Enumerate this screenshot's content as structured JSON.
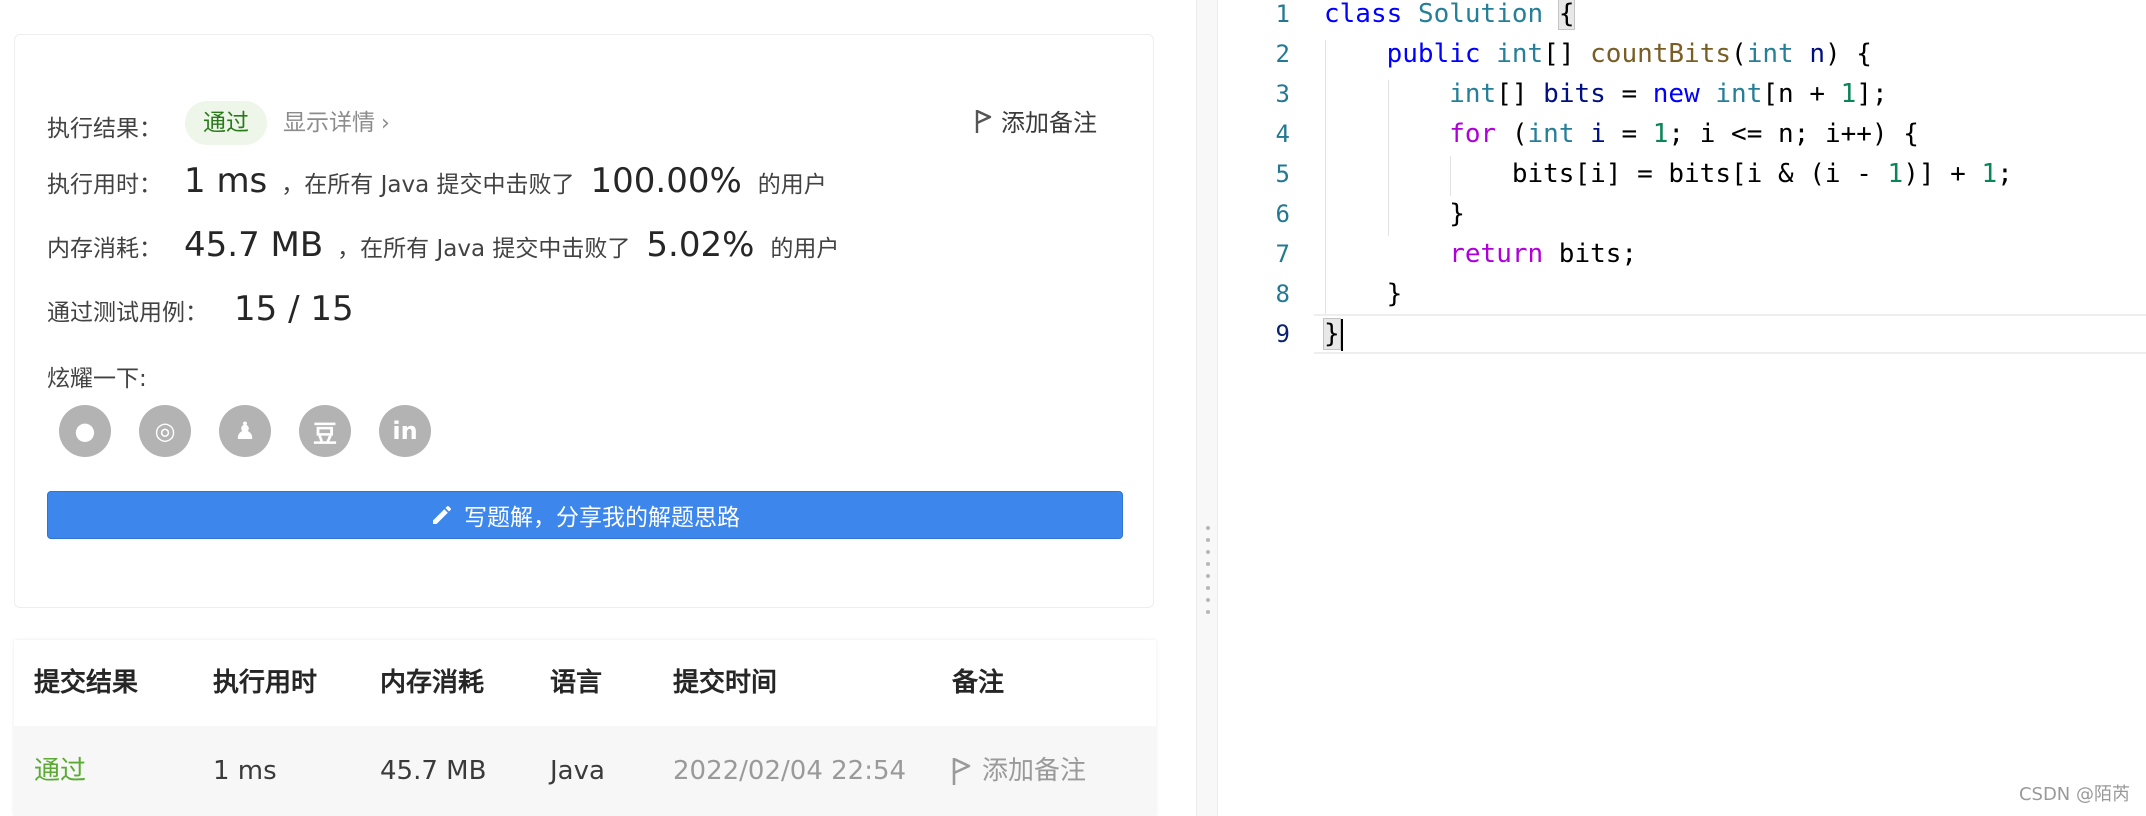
{
  "result": {
    "status_label": "执行结果：",
    "status_badge": "通过",
    "details_link": "显示详情",
    "details_chevron": "›",
    "add_note": "添加备注",
    "runtime_label": "执行用时：",
    "runtime_value": "1 ms",
    "runtime_beat_text": "，在所有 Java 提交中击败了",
    "runtime_percent": "100.00%",
    "runtime_users": "的用户",
    "memory_label": "内存消耗：",
    "memory_value": "45.7 MB",
    "memory_beat_text": "，在所有 Java 提交中击败了",
    "memory_percent": "5.02%",
    "memory_users": "的用户",
    "tests_label": "通过测试用例：",
    "tests_value": "15 / 15",
    "share_label": "炫耀一下:",
    "share_icons": [
      "wechat-icon",
      "weibo-icon",
      "qq-icon",
      "douban-icon",
      "linkedin-icon"
    ],
    "share_glyphs": [
      "●",
      "◎",
      "♟",
      "豆",
      "in"
    ],
    "write_button": "写题解，分享我的解题思路"
  },
  "table": {
    "headers": [
      "提交结果",
      "执行用时",
      "内存消耗",
      "语言",
      "提交时间",
      "备注"
    ],
    "rows": [
      {
        "result": "通过",
        "time": "1 ms",
        "memory": "45.7 MB",
        "language": "Java",
        "submitted": "2022/02/04 22:54",
        "note": "添加备注"
      }
    ]
  },
  "editor": {
    "line_numbers": [
      "1",
      "2",
      "3",
      "4",
      "5",
      "6",
      "7",
      "8",
      "9"
    ]
  },
  "watermark": "CSDN @陌芮",
  "colors": {
    "accent": "#3d87ec",
    "pass": "#5aaa34",
    "badge_bg": "#eef6ea"
  }
}
